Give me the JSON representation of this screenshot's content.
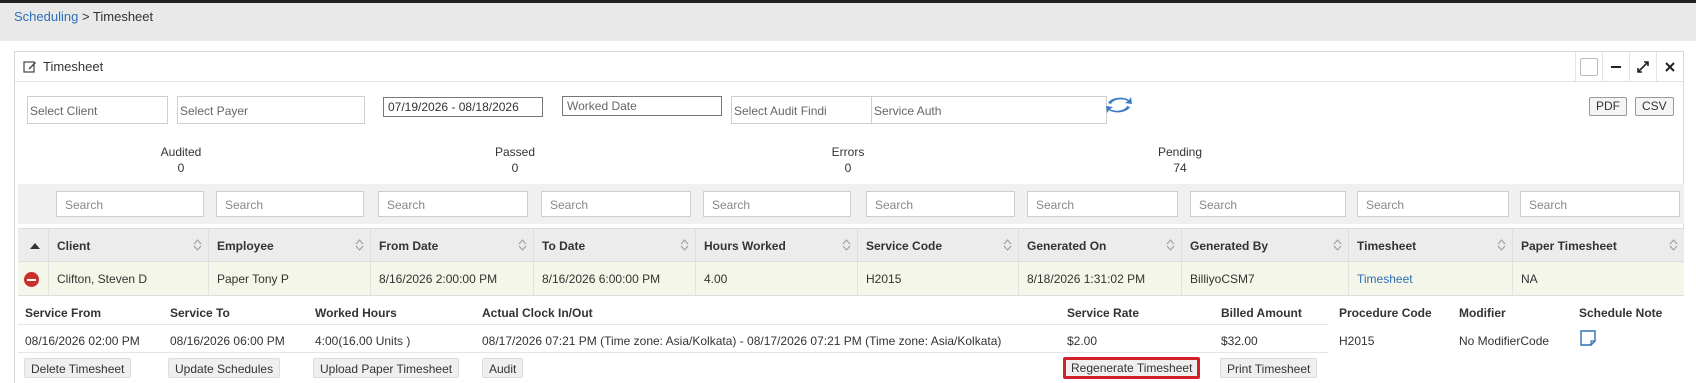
{
  "breadcrumb": {
    "parent": "Scheduling",
    "separator": " > ",
    "current": "Timesheet"
  },
  "panel": {
    "title": "Timesheet"
  },
  "filters": {
    "client_placeholder": "Select Client",
    "payer_placeholder": "Select Payer",
    "date_range": "07/19/2026 - 08/18/2026",
    "worked_date_placeholder": "Worked Date",
    "audit_placeholder": "Select Audit Findi",
    "service_auth_placeholder": "Service Auth"
  },
  "export": {
    "pdf": "PDF",
    "csv": "CSV"
  },
  "stats": [
    {
      "label": "Audited",
      "value": "0"
    },
    {
      "label": "Passed",
      "value": "0"
    },
    {
      "label": "Errors",
      "value": "0"
    },
    {
      "label": "Pending",
      "value": "74"
    }
  ],
  "search_placeholder": "Search",
  "columns": [
    "Client",
    "Employee",
    "From Date",
    "To Date",
    "Hours Worked",
    "Service Code",
    "Generated On",
    "Generated By",
    "Timesheet",
    "Paper Timesheet"
  ],
  "row": {
    "client": "Clifton, Steven D",
    "employee": "Paper Tony P",
    "from_date": "8/16/2026 2:00:00 PM",
    "to_date": "8/16/2026 6:00:00 PM",
    "hours_worked": "4.00",
    "service_code": "H2015",
    "generated_on": "8/18/2026 1:31:02 PM",
    "generated_by": "BilliyoCSM7",
    "timesheet": "Timesheet",
    "paper_timesheet": "NA"
  },
  "detail": {
    "headers": [
      "Service From",
      "Service To",
      "Worked Hours",
      "Actual Clock In/Out",
      "Service Rate",
      "Billed Amount",
      "Procedure Code",
      "Modifier",
      "Schedule Note"
    ],
    "values": {
      "service_from": "08/16/2026 02:00 PM",
      "service_to": "08/16/2026 06:00 PM",
      "worked_hours": "4:00(16.00 Units )",
      "clock": "08/17/2026 07:21 PM (Time zone: Asia/Kolkata) - 08/17/2026 07:21 PM (Time zone: Asia/Kolkata)",
      "service_rate": "$2.00",
      "billed_amount": "$32.00",
      "procedure_code": "H2015",
      "modifier": "No ModifierCode"
    },
    "actions": {
      "delete": "Delete Timesheet",
      "update": "Update Schedules",
      "upload": "Upload Paper Timesheet",
      "audit": "Audit",
      "regenerate": "Regenerate Timesheet",
      "print": "Print Timesheet"
    }
  },
  "colors": {
    "link": "#2f6fb5",
    "highlight": "#d2202a",
    "row_bg": "#f4f6e9"
  }
}
